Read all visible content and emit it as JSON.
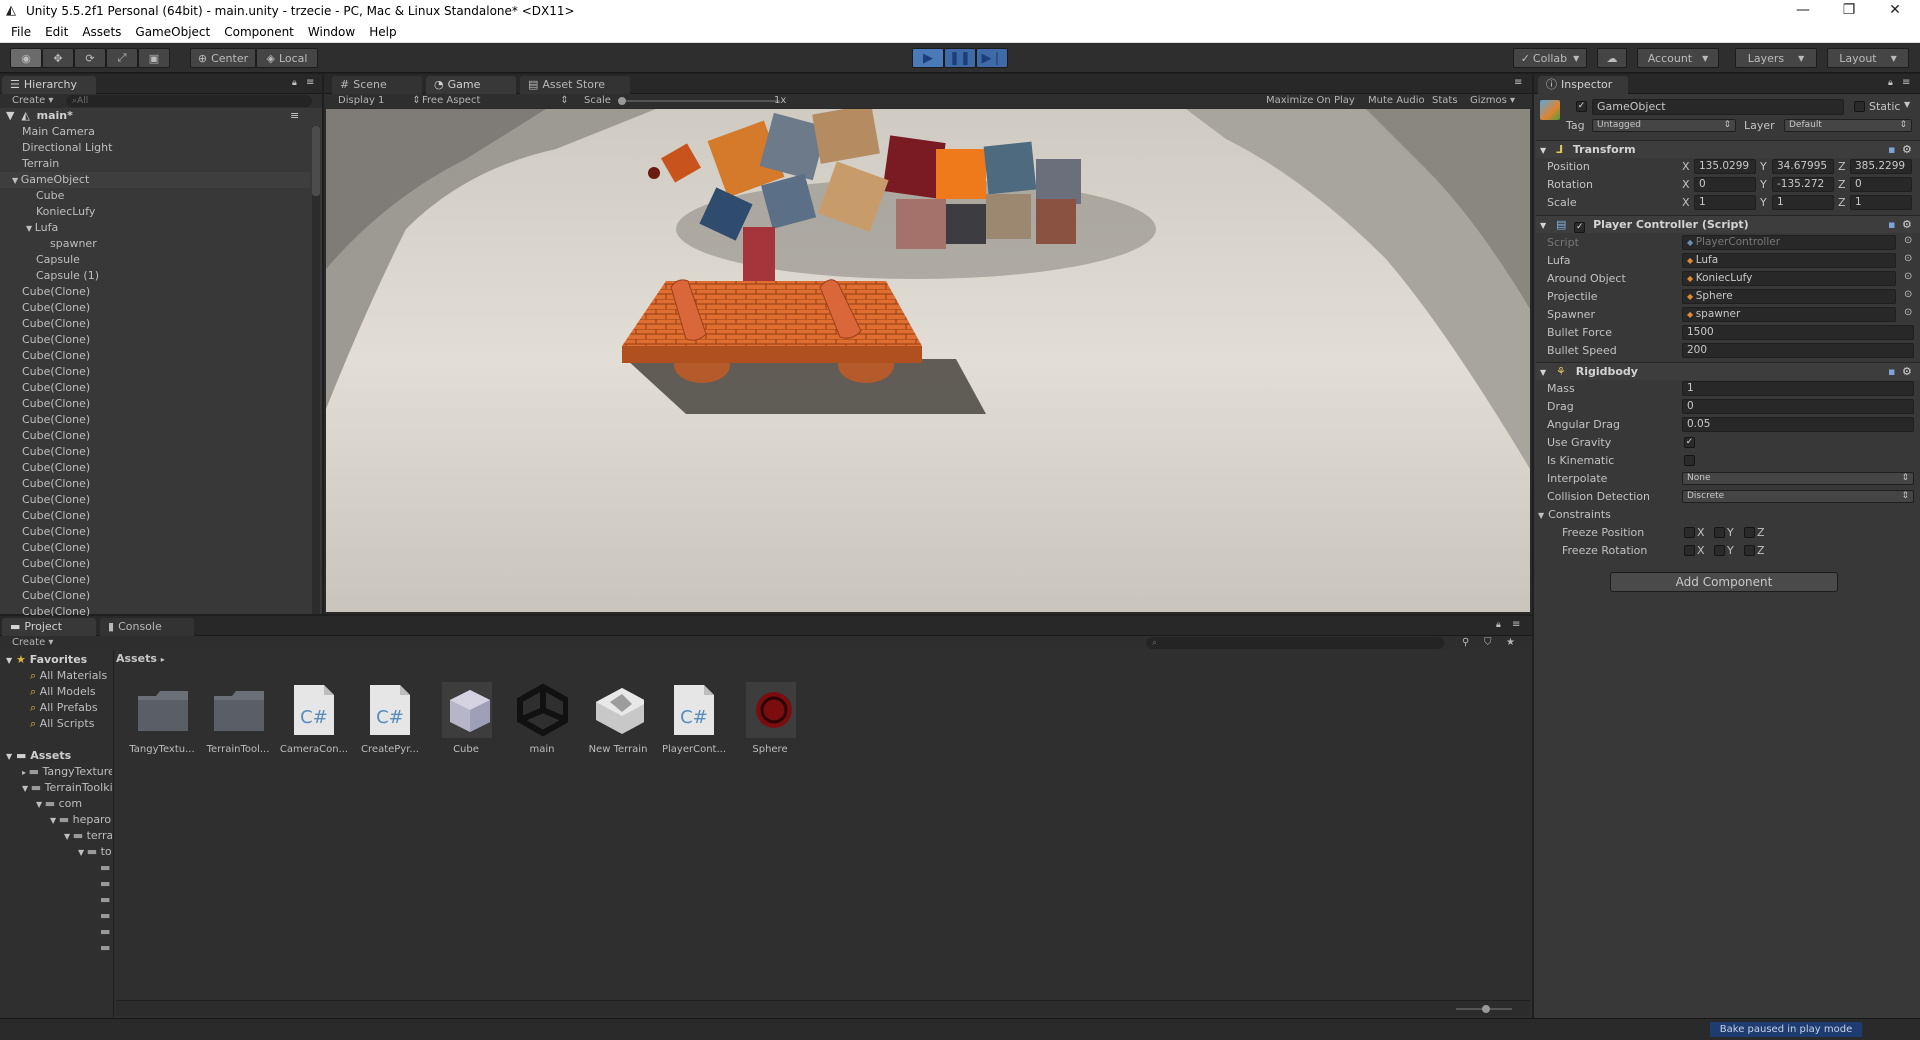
{
  "window": {
    "title": "Unity 5.5.2f1 Personal (64bit) - main.unity - trzecie - PC, Mac & Linux Standalone* <DX11>",
    "minimize": "—",
    "maximize": "❐",
    "close": "✕"
  },
  "menu": [
    "File",
    "Edit",
    "Assets",
    "GameObject",
    "Component",
    "Window",
    "Help"
  ],
  "toolbar": {
    "pivot": "Center",
    "space": "Local",
    "collab": "Collab",
    "account": "Account",
    "layers": "Layers",
    "layout": "Layout"
  },
  "hierarchy": {
    "tab": "Hierarchy",
    "create": "Create",
    "search_placeholder": "All",
    "scene": "main*",
    "items": [
      {
        "label": "Main Camera",
        "indent": 1
      },
      {
        "label": "Directional Light",
        "indent": 1
      },
      {
        "label": "Terrain",
        "indent": 1
      },
      {
        "label": "GameObject",
        "indent": 1,
        "expanded": true,
        "selected": true
      },
      {
        "label": "Cube",
        "indent": 2
      },
      {
        "label": "KoniecLufy",
        "indent": 2
      },
      {
        "label": "Lufa",
        "indent": 2,
        "expanded": true
      },
      {
        "label": "spawner",
        "indent": 3
      },
      {
        "label": "Capsule",
        "indent": 2
      },
      {
        "label": "Capsule (1)",
        "indent": 2
      },
      {
        "label": "Cube(Clone)",
        "indent": 1
      },
      {
        "label": "Cube(Clone)",
        "indent": 1
      },
      {
        "label": "Cube(Clone)",
        "indent": 1
      },
      {
        "label": "Cube(Clone)",
        "indent": 1
      },
      {
        "label": "Cube(Clone)",
        "indent": 1
      },
      {
        "label": "Cube(Clone)",
        "indent": 1
      },
      {
        "label": "Cube(Clone)",
        "indent": 1
      },
      {
        "label": "Cube(Clone)",
        "indent": 1
      },
      {
        "label": "Cube(Clone)",
        "indent": 1
      },
      {
        "label": "Cube(Clone)",
        "indent": 1
      },
      {
        "label": "Cube(Clone)",
        "indent": 1
      },
      {
        "label": "Cube(Clone)",
        "indent": 1
      },
      {
        "label": "Cube(Clone)",
        "indent": 1
      },
      {
        "label": "Cube(Clone)",
        "indent": 1
      },
      {
        "label": "Cube(Clone)",
        "indent": 1
      },
      {
        "label": "Cube(Clone)",
        "indent": 1
      },
      {
        "label": "Cube(Clone)",
        "indent": 1
      },
      {
        "label": "Cube(Clone)",
        "indent": 1
      },
      {
        "label": "Cube(Clone)",
        "indent": 1
      },
      {
        "label": "Cube(Clone)",
        "indent": 1
      },
      {
        "label": "Cube(Clone)",
        "indent": 1
      }
    ]
  },
  "center_tabs": {
    "scene": "Scene",
    "game": "Game",
    "asset_store": "Asset Store"
  },
  "game_bar": {
    "display": "Display 1",
    "aspect": "Free Aspect",
    "scale_label": "Scale",
    "scale_value": "1x",
    "maximize": "Maximize On Play",
    "mute": "Mute Audio",
    "stats": "Stats",
    "gizmos": "Gizmos"
  },
  "inspector": {
    "tab": "Inspector",
    "object_name": "GameObject",
    "static_label": "Static",
    "tag_label": "Tag",
    "tag_value": "Untagged",
    "layer_label": "Layer",
    "layer_value": "Default",
    "transform": {
      "title": "Transform",
      "position_label": "Position",
      "rotation_label": "Rotation",
      "scale_label": "Scale",
      "position": {
        "x": "135.0299",
        "y": "34.67995",
        "z": "385.2299"
      },
      "rotation": {
        "x": "0",
        "y": "-135.272",
        "z": "0"
      },
      "scale": {
        "x": "1",
        "y": "1",
        "z": "1"
      }
    },
    "player_controller": {
      "title": "Player Controller (Script)",
      "fields": [
        {
          "label": "Script",
          "value": "PlayerController",
          "kind": "script"
        },
        {
          "label": "Lufa",
          "value": "Lufa",
          "kind": "object"
        },
        {
          "label": "Around Object",
          "value": "KoniecLufy",
          "kind": "object"
        },
        {
          "label": "Projectile",
          "value": "Sphere",
          "kind": "object"
        },
        {
          "label": "Spawner",
          "value": "spawner",
          "kind": "object"
        },
        {
          "label": "Bullet Force",
          "value": "1500",
          "kind": "number"
        },
        {
          "label": "Bullet Speed",
          "value": "200",
          "kind": "number"
        }
      ]
    },
    "rigidbody": {
      "title": "Rigidbody",
      "mass_label": "Mass",
      "mass": "1",
      "drag_label": "Drag",
      "drag": "0",
      "angular_drag_label": "Angular Drag",
      "angular_drag": "0.05",
      "use_gravity_label": "Use Gravity",
      "use_gravity": true,
      "is_kinematic_label": "Is Kinematic",
      "is_kinematic": false,
      "interpolate_label": "Interpolate",
      "interpolate": "None",
      "collision_label": "Collision Detection",
      "collision": "Discrete",
      "constraints_label": "Constraints",
      "freeze_position_label": "Freeze Position",
      "freeze_rotation_label": "Freeze Rotation"
    },
    "add_component": "Add Component"
  },
  "project": {
    "tab_project": "Project",
    "tab_console": "Console",
    "create": "Create",
    "favorites": "Favorites",
    "favorite_items": [
      "All Materials",
      "All Models",
      "All Prefabs",
      "All Scripts"
    ],
    "assets_root": "Assets",
    "tree": [
      {
        "label": "TangyTextures",
        "indent": 1
      },
      {
        "label": "TerrainToolkit",
        "indent": 1
      },
      {
        "label": "com",
        "indent": 2
      },
      {
        "label": "heparo",
        "indent": 3
      },
      {
        "label": "terrain",
        "indent": 4
      },
      {
        "label": "to",
        "indent": 5
      }
    ],
    "breadcrumb": "Assets",
    "assets": [
      {
        "label": "TangyTextu...",
        "icon": "folder-icon"
      },
      {
        "label": "TerrainTool...",
        "icon": "folder-icon"
      },
      {
        "label": "CameraCon...",
        "icon": "csharp-script-icon"
      },
      {
        "label": "CreatePyr...",
        "icon": "csharp-script-icon"
      },
      {
        "label": "Cube",
        "icon": "cube-prefab-icon"
      },
      {
        "label": "main",
        "icon": "unity-scene-icon"
      },
      {
        "label": "New Terrain",
        "icon": "terrain-icon"
      },
      {
        "label": "PlayerCont...",
        "icon": "csharp-script-icon"
      },
      {
        "label": "Sphere",
        "icon": "sphere-material-icon"
      }
    ]
  },
  "status": {
    "bake": "Bake paused in play mode"
  },
  "colors": {
    "accent_play": "#4a7ab8",
    "panel": "#383838",
    "field": "#282828",
    "brick": "#d8662e"
  }
}
